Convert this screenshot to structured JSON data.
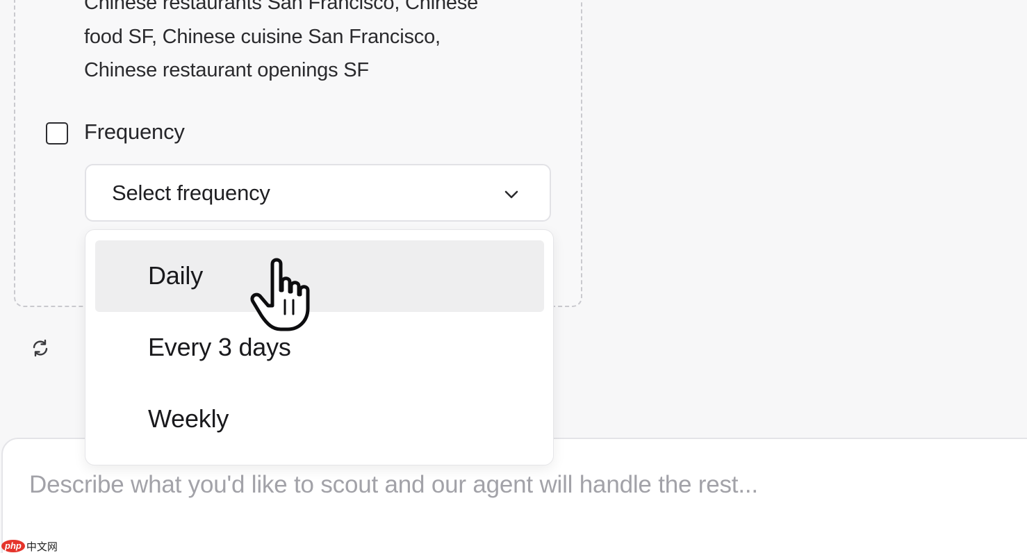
{
  "filter_card": {
    "keywords_lines": [
      "Chinese restaurants San Francisco, Chinese",
      "food SF, Chinese cuisine San Francisco,",
      "Chinese restaurant openings SF"
    ],
    "frequency": {
      "label": "Frequency",
      "checked": false,
      "select": {
        "placeholder": "Select frequency",
        "icon": "chevron-down-icon",
        "options": [
          "Daily",
          "Every 3 days",
          "Weekly"
        ],
        "highlighted": "Daily"
      }
    }
  },
  "refresh": {
    "icon": "refresh-icon"
  },
  "composer": {
    "placeholder": "Describe what you'd like to scout and our agent will handle the rest..."
  },
  "cursor": {
    "icon": "hand-pointer-icon"
  },
  "watermark": {
    "logo": "php",
    "text": "中文网"
  },
  "colors": {
    "highlight": "#eeeeef",
    "border": "#e2e2e6",
    "dashed_border": "#c9c9ce",
    "placeholder_text": "#a2a2a8"
  }
}
